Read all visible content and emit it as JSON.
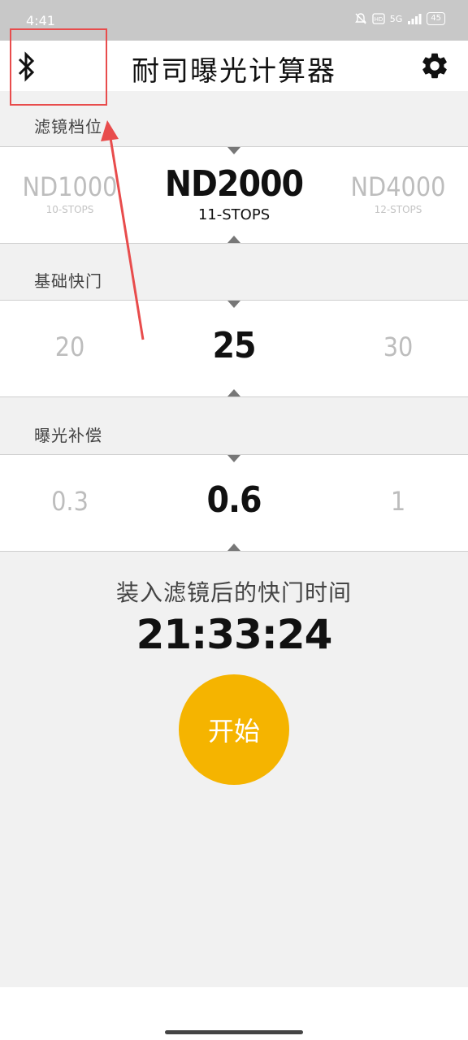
{
  "status": {
    "time": "4:41",
    "network": "5G",
    "battery": "45"
  },
  "appbar": {
    "title": "耐司曝光计算器"
  },
  "filter": {
    "label": "滤镜档位",
    "options": [
      {
        "name": "ND1000",
        "stops": "10-STOPS"
      },
      {
        "name": "ND2000",
        "stops": "11-STOPS"
      },
      {
        "name": "ND4000",
        "stops": "12-STOPS"
      }
    ]
  },
  "shutter": {
    "label": "基础快门",
    "options": [
      "20",
      "25",
      "30"
    ]
  },
  "compensation": {
    "label": "曝光补偿",
    "options": [
      "0.3",
      "0.6",
      "1"
    ]
  },
  "result": {
    "label": "装入滤镜后的快门时间",
    "value": "21:33:24"
  },
  "start_button": {
    "label": "开始"
  },
  "colors": {
    "accent": "#f5b400",
    "annotation": "#e84c4c"
  },
  "icons": {
    "bluetooth": "bluetooth-icon",
    "settings": "gear-icon"
  }
}
